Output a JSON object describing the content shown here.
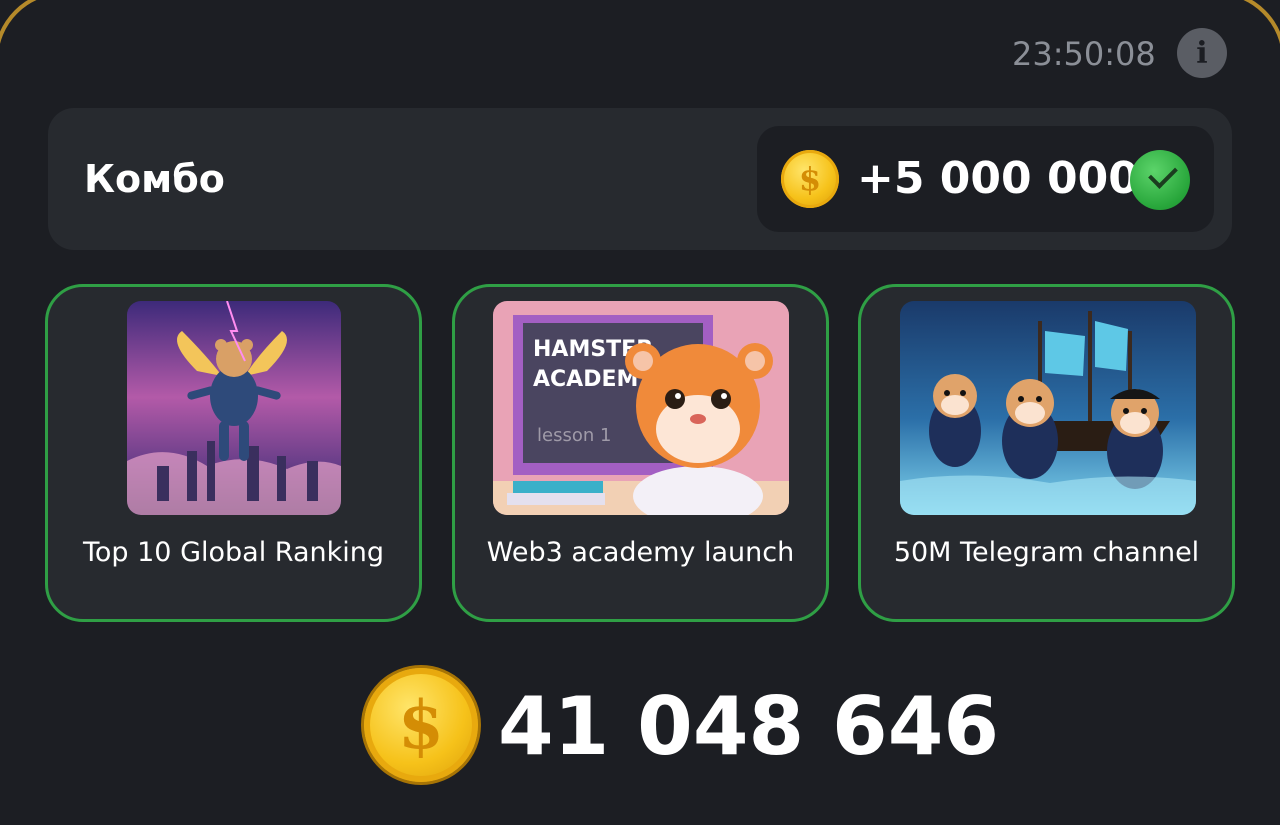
{
  "header": {
    "timer": "23:50:08",
    "info_icon": "i"
  },
  "combo": {
    "title": "Комбо",
    "reward": "+5 000 000",
    "coin_icon": "$",
    "status_icon": "check-icon"
  },
  "cards": [
    {
      "label": "Top 10 Global Ranking",
      "image": "hamster-astronaut-flying-over-city"
    },
    {
      "label": "Web3 academy launch",
      "image": "hamster-academy-lesson-1",
      "image_text": [
        "HAMSTER",
        "ACADEMY",
        "lesson 1"
      ]
    },
    {
      "label": "50M Telegram channel",
      "image": "hamster-pirates-with-ship"
    }
  ],
  "balance": {
    "value": "41 048 646",
    "coin_icon": "$"
  },
  "colors": {
    "background": "#1c1e23",
    "card_border": "#2f9f45",
    "coin": "#f6c21a",
    "accent_frame": "#b58a2a"
  }
}
